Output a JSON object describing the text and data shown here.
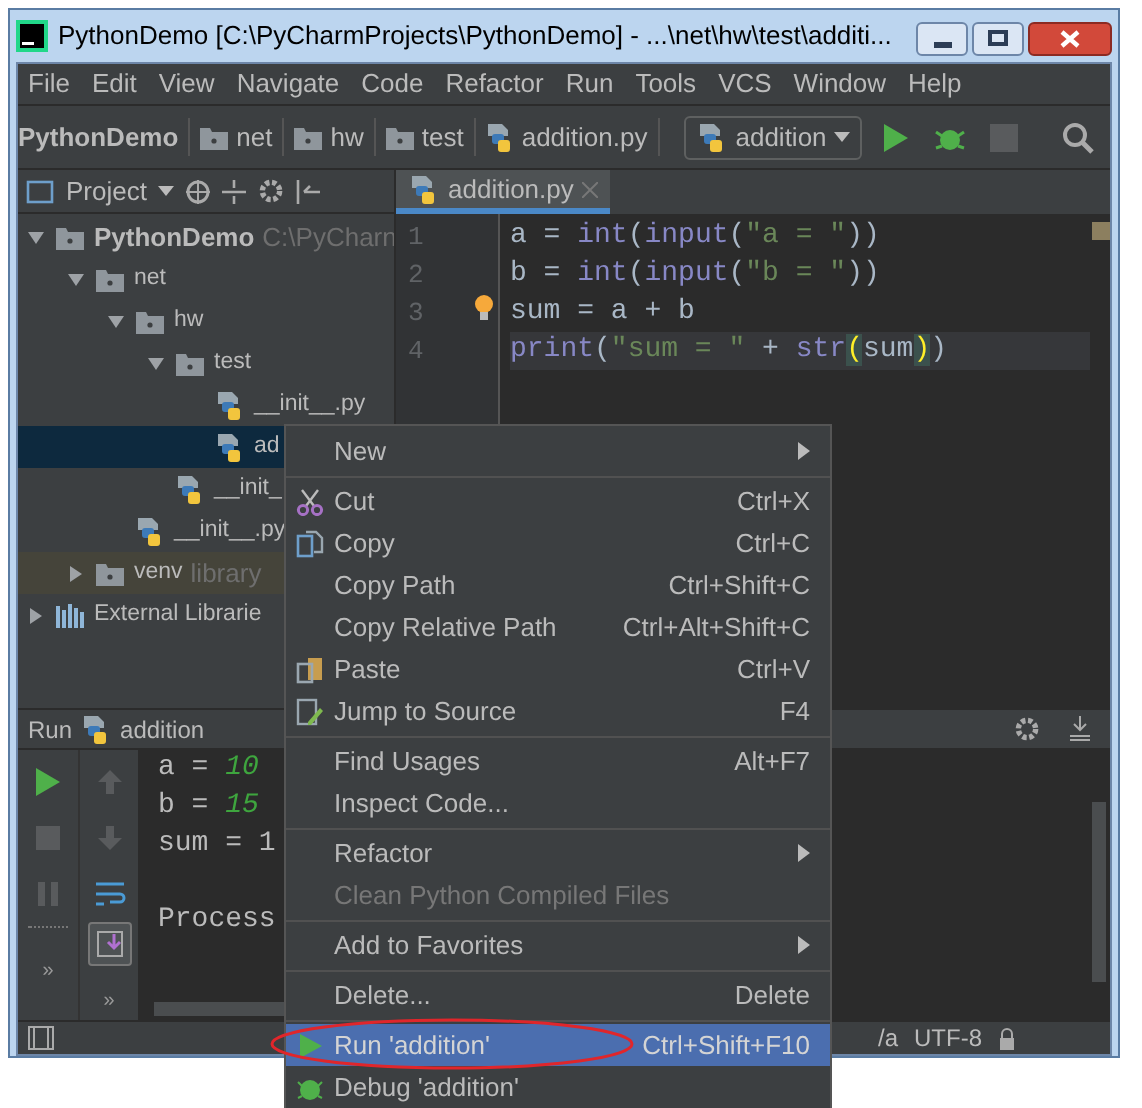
{
  "window": {
    "title": "PythonDemo [C:\\PyCharmProjects\\PythonDemo] - ...\\net\\hw\\test\\additi..."
  },
  "menu_bar": [
    "File",
    "Edit",
    "View",
    "Navigate",
    "Code",
    "Refactor",
    "Run",
    "Tools",
    "VCS",
    "Window",
    "Help"
  ],
  "breadcrumbs": [
    {
      "label": "PythonDemo",
      "kind": "project"
    },
    {
      "label": "net",
      "kind": "folder"
    },
    {
      "label": "hw",
      "kind": "folder"
    },
    {
      "label": "test",
      "kind": "folder"
    },
    {
      "label": "addition.py",
      "kind": "python"
    }
  ],
  "run_config": "addition",
  "project_panel": {
    "title": "Project"
  },
  "editor_tab": {
    "label": "addition.py",
    "selected": true
  },
  "tree": [
    {
      "label": "PythonDemo",
      "hint": "C:\\PyCharn",
      "kind": "folder",
      "expanded": true,
      "selected": false,
      "children": [
        {
          "label": "net",
          "kind": "folder",
          "expanded": true,
          "selected": false,
          "children": [
            {
              "label": "hw",
              "kind": "folder",
              "expanded": true,
              "selected": false,
              "children": [
                {
                  "label": "test",
                  "kind": "folder",
                  "expanded": true,
                  "selected": false,
                  "children": [
                    {
                      "label": "__init__.py",
                      "kind": "python",
                      "selected": false
                    },
                    {
                      "label": "ad",
                      "kind": "python",
                      "selected": true
                    }
                  ]
                },
                {
                  "label": "__init_",
                  "kind": "python",
                  "selected": false
                }
              ]
            },
            {
              "label": "__init__.py",
              "kind": "python",
              "selected": false
            }
          ]
        },
        {
          "label": "venv",
          "hint": "library",
          "kind": "excluded",
          "expanded": false,
          "selected": false
        }
      ]
    },
    {
      "label": "External Librarie",
      "kind": "library",
      "expanded": false,
      "selected": false
    }
  ],
  "editor": {
    "line_numbers": [
      "1",
      "2",
      "3",
      "4"
    ],
    "lines": [
      {
        "current": false,
        "tokens": [
          {
            "text": "a = ",
            "kind": "plain"
          },
          {
            "text": "int",
            "kind": "builtin"
          },
          {
            "text": "(",
            "kind": "plain"
          },
          {
            "text": "input",
            "kind": "builtin"
          },
          {
            "text": "(",
            "kind": "plain"
          },
          {
            "text": "\"a = \"",
            "kind": "string"
          },
          {
            "text": "))",
            "kind": "plain"
          }
        ]
      },
      {
        "current": false,
        "tokens": [
          {
            "text": "b = ",
            "kind": "plain"
          },
          {
            "text": "int",
            "kind": "builtin"
          },
          {
            "text": "(",
            "kind": "plain"
          },
          {
            "text": "input",
            "kind": "builtin"
          },
          {
            "text": "(",
            "kind": "plain"
          },
          {
            "text": "\"b = \"",
            "kind": "string"
          },
          {
            "text": "))",
            "kind": "plain"
          }
        ]
      },
      {
        "current": false,
        "tokens": [
          {
            "text": "sum = a + b",
            "kind": "plain"
          }
        ]
      },
      {
        "current": true,
        "tokens": [
          {
            "text": "print",
            "kind": "builtin"
          },
          {
            "text": "(",
            "kind": "plain"
          },
          {
            "text": "\"sum = \"",
            "kind": "string"
          },
          {
            "text": " + ",
            "kind": "plain"
          },
          {
            "text": "str",
            "kind": "builtin"
          },
          {
            "text": "(",
            "kind": "match"
          },
          {
            "text": "sum",
            "kind": "plain"
          },
          {
            "text": ")",
            "kind": "match"
          },
          {
            "text": ")",
            "kind": "plain"
          }
        ]
      }
    ]
  },
  "run_panel": {
    "label": "Run",
    "config": "addition",
    "toolbar_overflow": [
      "»",
      "»"
    ],
    "console": [
      {
        "blank_before": false,
        "tokens": [
          {
            "text": "a = ",
            "kind": "plain"
          },
          {
            "text": "10",
            "kind": "input"
          }
        ]
      },
      {
        "blank_before": false,
        "tokens": [
          {
            "text": "b = ",
            "kind": "plain"
          },
          {
            "text": "15",
            "kind": "input"
          }
        ]
      },
      {
        "blank_before": false,
        "tokens": [
          {
            "text": "sum = 1",
            "kind": "plain"
          }
        ]
      },
      {
        "blank_before": true,
        "tokens": [
          {
            "text": "Process",
            "kind": "plain"
          }
        ]
      }
    ]
  },
  "status_bar": {
    "line_separator": "/a",
    "encoding": "UTF-8"
  },
  "context_menu": [
    {
      "kind": "item",
      "label": "New",
      "submenu": true,
      "disabled": false,
      "selected": false
    },
    {
      "kind": "separator"
    },
    {
      "kind": "item",
      "label": "Cut",
      "shortcut": "Ctrl+X",
      "disabled": false,
      "selected": false
    },
    {
      "kind": "item",
      "label": "Copy",
      "shortcut": "Ctrl+C",
      "disabled": false,
      "selected": false
    },
    {
      "kind": "item",
      "label": "Copy Path",
      "shortcut": "Ctrl+Shift+C",
      "disabled": false,
      "selected": false
    },
    {
      "kind": "item",
      "label": "Copy Relative Path",
      "shortcut": "Ctrl+Alt+Shift+C",
      "disabled": false,
      "selected": false
    },
    {
      "kind": "item",
      "label": "Paste",
      "shortcut": "Ctrl+V",
      "disabled": false,
      "selected": false
    },
    {
      "kind": "item",
      "label": "Jump to Source",
      "shortcut": "F4",
      "disabled": false,
      "selected": false
    },
    {
      "kind": "separator"
    },
    {
      "kind": "item",
      "label": "Find Usages",
      "shortcut": "Alt+F7",
      "disabled": false,
      "selected": false
    },
    {
      "kind": "item",
      "label": "Inspect Code...",
      "disabled": false,
      "selected": false
    },
    {
      "kind": "separator"
    },
    {
      "kind": "item",
      "label": "Refactor",
      "submenu": true,
      "disabled": false,
      "selected": false
    },
    {
      "kind": "item",
      "label": "Clean Python Compiled Files",
      "disabled": true,
      "selected": false
    },
    {
      "kind": "separator"
    },
    {
      "kind": "item",
      "label": "Add to Favorites",
      "submenu": true,
      "disabled": false,
      "selected": false
    },
    {
      "kind": "separator"
    },
    {
      "kind": "item",
      "label": "Delete...",
      "shortcut": "Delete",
      "disabled": false,
      "selected": false
    },
    {
      "kind": "separator"
    },
    {
      "kind": "item",
      "label": "Run 'addition'",
      "shortcut": "Ctrl+Shift+F10",
      "disabled": false,
      "selected": true,
      "circled": true
    },
    {
      "kind": "item",
      "label": "Debug 'addition'",
      "disabled": false,
      "selected": false
    }
  ]
}
